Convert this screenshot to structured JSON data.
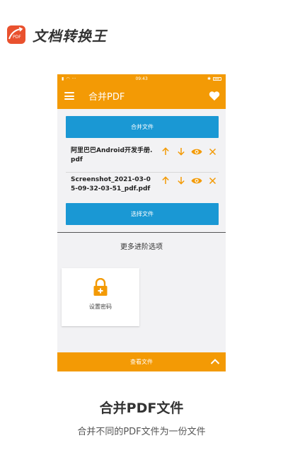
{
  "brand": {
    "title": "文档转换王",
    "logo_text": "PDF",
    "logo_color": "#e9512e"
  },
  "phone": {
    "status": {
      "time": "09:43"
    },
    "toolbar": {
      "title": "合并PDF"
    },
    "merge_button": "合并文件",
    "files": [
      {
        "name": "阿里巴巴Android开发手册.pdf"
      },
      {
        "name": "Screenshot_2021-03-05-09-32-03-51_pdf.pdf"
      }
    ],
    "select_button": "选择文件",
    "advanced_title": "更多进阶选项",
    "password_card_label": "设置密码",
    "bottom_bar_label": "查看文件",
    "colors": {
      "accent": "#f39a05",
      "button": "#1a98d4"
    }
  },
  "caption": {
    "title": "合并PDF文件",
    "subtitle": "合并不同的PDF文件为一份文件"
  }
}
